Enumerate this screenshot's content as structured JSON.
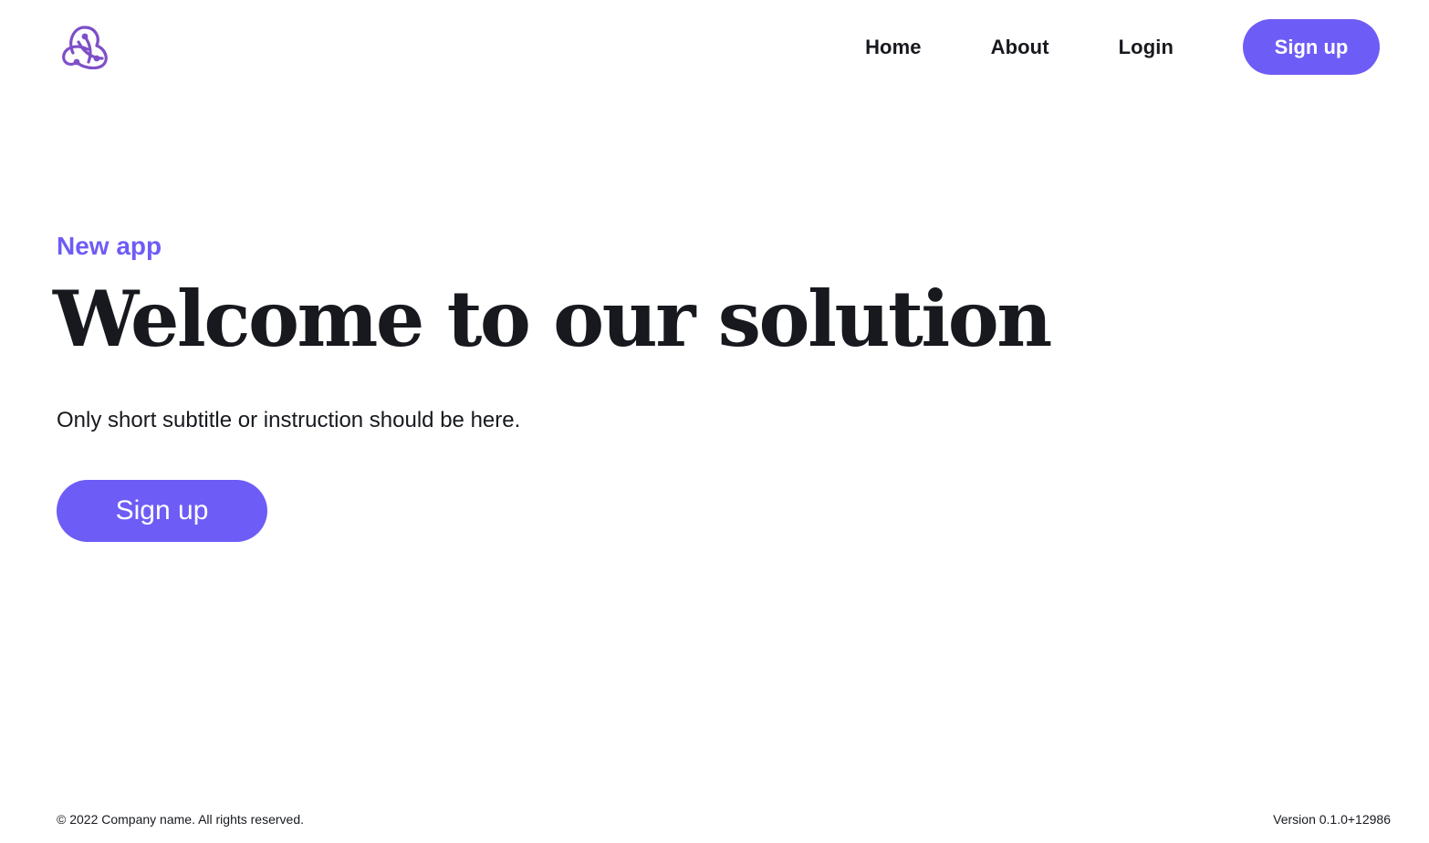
{
  "header": {
    "logo_icon": "redux-logo-icon",
    "nav": {
      "home_label": "Home",
      "about_label": "About",
      "login_label": "Login",
      "signup_label": "Sign up"
    }
  },
  "hero": {
    "eyebrow": "New app",
    "title": "Welcome to our solution",
    "subtitle": "Only short subtitle or instruction should be here.",
    "cta_label": "Sign up"
  },
  "footer": {
    "copyright": "© 2022 Company name. All rights reserved.",
    "version": "Version 0.1.0+12986"
  },
  "colors": {
    "accent": "#6e5cf6",
    "text": "#17191e",
    "background": "#ffffff",
    "logo": "#7e4fc7"
  }
}
